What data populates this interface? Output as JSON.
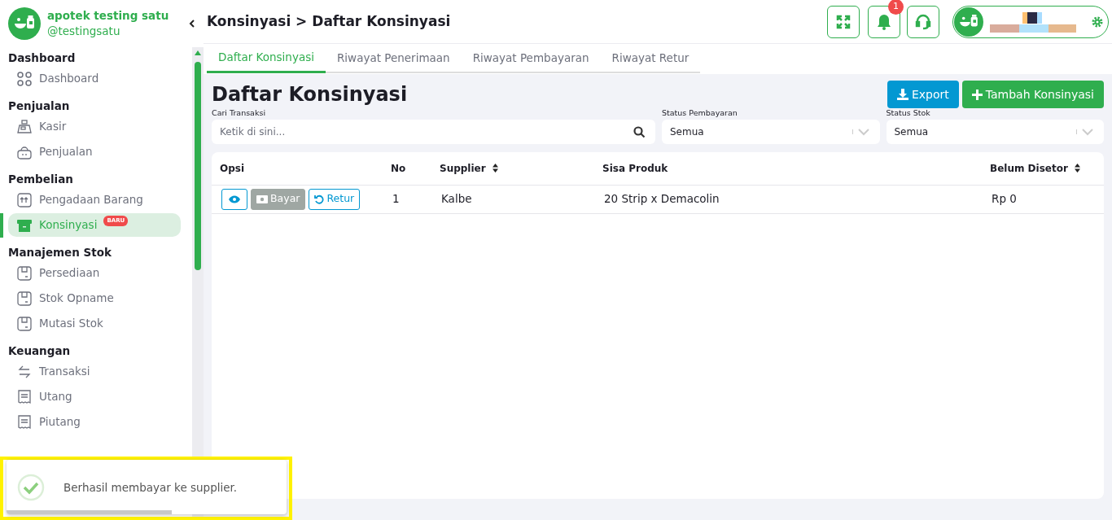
{
  "brand": {
    "name": "apotek testing satu",
    "handle": "@testingsatu"
  },
  "sidebar": {
    "sections": [
      {
        "heading": "Dashboard",
        "items": [
          {
            "label": "Dashboard",
            "selected": false
          }
        ]
      },
      {
        "heading": "Penjualan",
        "items": [
          {
            "label": "Kasir",
            "selected": false
          },
          {
            "label": "Penjualan",
            "selected": false
          }
        ]
      },
      {
        "heading": "Pembelian",
        "items": [
          {
            "label": "Pengadaan Barang",
            "selected": false
          },
          {
            "label": "Konsinyasi",
            "badge": "BARU",
            "selected": true
          }
        ]
      },
      {
        "heading": "Manajemen Stok",
        "items": [
          {
            "label": "Persediaan",
            "selected": false
          },
          {
            "label": "Stok Opname",
            "selected": false
          },
          {
            "label": "Mutasi Stok",
            "selected": false
          }
        ]
      },
      {
        "heading": "Keuangan",
        "items": [
          {
            "label": "Transaksi",
            "selected": false
          },
          {
            "label": "Utang",
            "selected": false
          },
          {
            "label": "Piutang",
            "selected": false
          }
        ]
      }
    ]
  },
  "header": {
    "breadcrumb": "Konsinyasi > Daftar Konsinyasi",
    "notification_count": "1"
  },
  "tabs": [
    {
      "label": "Daftar Konsinyasi",
      "selected": true
    },
    {
      "label": "Riwayat Penerimaan",
      "selected": false
    },
    {
      "label": "Riwayat Pembayaran",
      "selected": false
    },
    {
      "label": "Riwayat Retur",
      "selected": false
    }
  ],
  "page": {
    "title": "Daftar Konsinyasi",
    "buttons": [
      {
        "label": "Export",
        "kind": "export"
      },
      {
        "label": "Tambah Konsinyasi",
        "kind": "add"
      }
    ]
  },
  "filters": [
    {
      "label": "Cari Transaksi",
      "placeholder": "Ketik di sini...",
      "kind": "search"
    },
    {
      "label": "Status Pembayaran",
      "value": "Semua",
      "kind": "select"
    },
    {
      "label": "Status Stok",
      "value": "Semua",
      "kind": "select"
    }
  ],
  "table": {
    "columns": [
      {
        "label": "Opsi",
        "sortable": false
      },
      {
        "label": "No",
        "sortable": false
      },
      {
        "label": "Supplier",
        "sortable": true
      },
      {
        "label": "Sisa Produk",
        "sortable": false
      },
      {
        "label": "Belum Disetor",
        "sortable": true
      }
    ],
    "rows": [
      {
        "opsi": [
          {
            "kind": "view",
            "disabled": false
          },
          {
            "kind": "pay",
            "label": "Bayar",
            "disabled": true
          },
          {
            "kind": "return",
            "label": "Retur",
            "disabled": false
          }
        ],
        "no": "1",
        "supplier": "Kalbe",
        "sisa_produk": "20 Strip x Demacolin",
        "belum_disetor": "Rp 0"
      }
    ]
  },
  "toast": {
    "message": "Berhasil membayar ke supplier.",
    "level": 0.59
  }
}
